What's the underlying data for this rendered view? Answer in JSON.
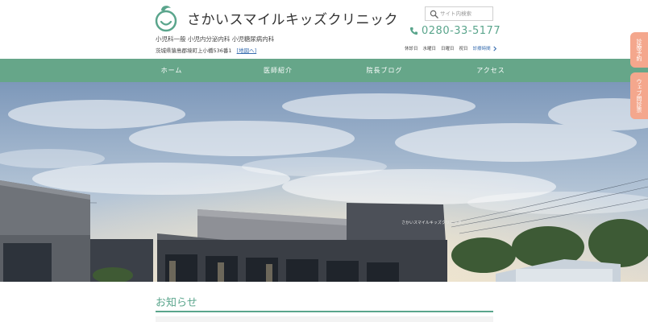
{
  "header": {
    "clinic_name": "さかいスマイルキッズクリニック",
    "subjects": "小児科一般  小児内分泌内科  小児糖尿病内科",
    "address": "茨城県猿島郡境町上小橋536番1",
    "map_link": "[地図へ]",
    "search_placeholder": "サイト内検索",
    "phone": "0280-33-5177",
    "closed_days": [
      "休診日",
      "水曜日",
      "日曜日",
      "祝日"
    ],
    "hours_link": "診療時間"
  },
  "nav": {
    "items": [
      "ホーム",
      "医師紹介",
      "院長ブログ",
      "アクセス"
    ]
  },
  "side": {
    "reserve": "診療予約",
    "web_interview": "ウェブ問診票"
  },
  "hero": {
    "building_sign": "さかいスマイルキッズクリニック"
  },
  "news": {
    "title": "お知らせ"
  },
  "colors": {
    "brand_green": "#66a689",
    "text_green": "#5aa58c",
    "accent_orange": "#f4a78d",
    "link_blue": "#3a6fb0"
  },
  "icons": [
    "logo-icon",
    "search-icon",
    "phone-icon",
    "chevron-right-icon"
  ]
}
